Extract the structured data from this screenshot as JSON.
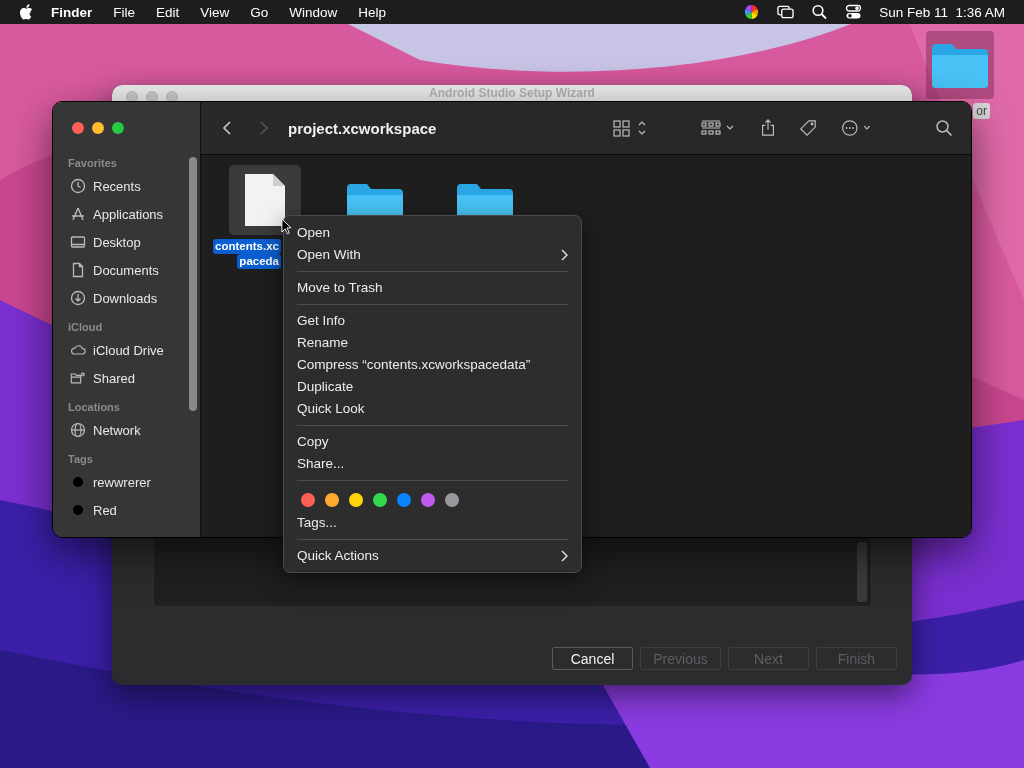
{
  "menu_bar": {
    "items": [
      {
        "label": "Finder",
        "kind": "app"
      },
      {
        "label": "File",
        "kind": "menu"
      },
      {
        "label": "Edit",
        "kind": "menu"
      },
      {
        "label": "View",
        "kind": "menu"
      },
      {
        "label": "Go",
        "kind": "menu"
      },
      {
        "label": "Window",
        "kind": "menu"
      },
      {
        "label": "Help",
        "kind": "menu"
      }
    ],
    "clock": "Sun Feb 11  1:36 AM"
  },
  "desktop_items": [
    {
      "label": "or",
      "kind": "folder"
    }
  ],
  "background_window": {
    "title": "Android Studio Setup Wizard",
    "buttons": [
      {
        "label": "Cancel",
        "disabled": false
      },
      {
        "label": "Previous",
        "disabled": true
      },
      {
        "label": "Next",
        "disabled": true
      },
      {
        "label": "Finish",
        "disabled": true
      }
    ]
  },
  "finder": {
    "title": "project.xcworkspace",
    "sidebar": [
      {
        "heading": "Favorites",
        "items": [
          {
            "label": "Recents",
            "kind": "clock"
          },
          {
            "label": "Applications",
            "kind": "apps"
          },
          {
            "label": "Desktop",
            "kind": "desktop"
          },
          {
            "label": "Documents",
            "kind": "document"
          },
          {
            "label": "Downloads",
            "kind": "download"
          }
        ]
      },
      {
        "heading": "iCloud",
        "items": [
          {
            "label": "iCloud Drive",
            "kind": "cloud"
          },
          {
            "label": "Shared",
            "kind": "shared"
          }
        ]
      },
      {
        "heading": "Locations",
        "items": [
          {
            "label": "Network",
            "kind": "globe"
          }
        ]
      },
      {
        "heading": "Tags",
        "items": [
          {
            "label": "rewwrerer",
            "kind": "tag",
            "color": "#000000"
          },
          {
            "label": "Red",
            "kind": "tag",
            "color": "#000000"
          }
        ]
      }
    ],
    "files": [
      {
        "kind": "document",
        "name_lines": [
          "contents.xc",
          "paceda"
        ],
        "selected": true
      },
      {
        "kind": "folder",
        "selected": false
      },
      {
        "kind": "folder",
        "selected": false
      }
    ]
  },
  "context_menu": {
    "items": [
      {
        "kind": "item",
        "label": "Open"
      },
      {
        "kind": "submenu",
        "label": "Open With"
      },
      {
        "kind": "separator"
      },
      {
        "kind": "item",
        "label": "Move to Trash"
      },
      {
        "kind": "separator"
      },
      {
        "kind": "item",
        "label": "Get Info"
      },
      {
        "kind": "item",
        "label": "Rename"
      },
      {
        "kind": "item",
        "label": "Compress “contents.xcworkspacedata”"
      },
      {
        "kind": "item",
        "label": "Duplicate"
      },
      {
        "kind": "item",
        "label": "Quick Look"
      },
      {
        "kind": "separator"
      },
      {
        "kind": "item",
        "label": "Copy"
      },
      {
        "kind": "item",
        "label": "Share..."
      },
      {
        "kind": "separator"
      },
      {
        "kind": "tags",
        "tag_colors": [
          {
            "color": "#ff5f57"
          },
          {
            "color": "#ffaa2c"
          },
          {
            "color": "#ffd60a"
          },
          {
            "color": "#32d74b"
          },
          {
            "color": "#0a84ff"
          },
          {
            "color": "#bf5af2"
          },
          {
            "color": "#98989d"
          }
        ]
      },
      {
        "kind": "item",
        "label": "Tags..."
      },
      {
        "kind": "separator"
      },
      {
        "kind": "submenu",
        "label": "Quick Actions"
      }
    ]
  }
}
